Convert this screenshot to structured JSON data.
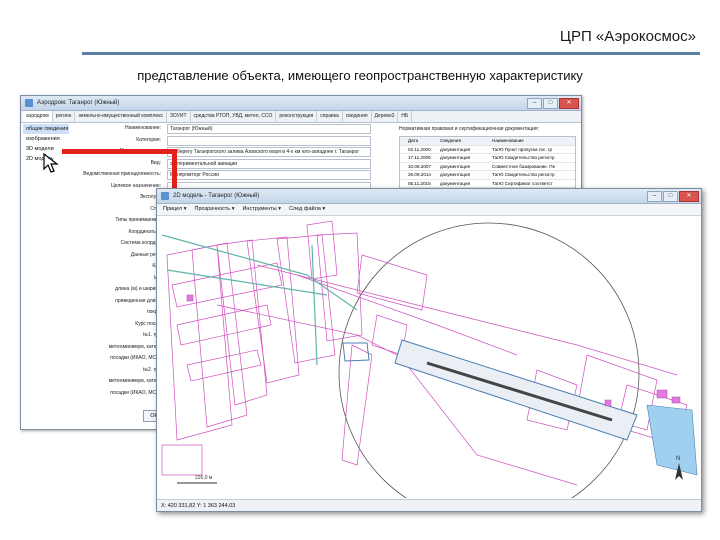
{
  "slide": {
    "title": "ЦРП «Аэрокосмос»",
    "subtitle": "представление объекта, имеющего геопространственную характеристику"
  },
  "colors": {
    "accent_rule": "#5b7fa7",
    "connector": "#e3201b",
    "map_lines": "#d04fbf",
    "runway": "#4b7fb0",
    "water": "#9fd0f0"
  },
  "window_back": {
    "title": "Аэродром: Таганрог (Южный)",
    "tabs": [
      "аэродром",
      "регион",
      "земельно-имущественный комплекс",
      "ЗОУИТ",
      "средства РТОП, УВД, метео, ССО",
      "реконструкция",
      "справка",
      "сведения",
      "Дерево3",
      "НБ"
    ],
    "nav": [
      "общие сведения",
      "изображения",
      "3D модели",
      "2D модель"
    ],
    "fields": [
      {
        "label": "Наименование:",
        "value": "Таганрог (Южный)"
      },
      {
        "label": "Категория:",
        "value": ""
      },
      {
        "label": "Местоположение:",
        "value": "на берегу Таганрогского залива Азовского моря в 4-х км юго-западнее г. Таганрог"
      },
      {
        "label": "Вид:",
        "value": "экспериментальной авиации"
      },
      {
        "label": "Ведомственная принадлежность:",
        "value": "Минпромторг России"
      },
      {
        "label": "Целевое назначение:",
        "value": ""
      },
      {
        "label": "Эксплуат",
        "value": ""
      },
      {
        "label": "Стат",
        "value": ""
      },
      {
        "label": "Типы принимаемых",
        "value": ""
      },
      {
        "label": "Координаты К",
        "value": ""
      },
      {
        "label": "Система координ",
        "value": ""
      },
      {
        "label": "Данные реес",
        "value": ""
      },
      {
        "label": "Кла",
        "value": ""
      },
      {
        "label": "ИВ",
        "value": ""
      },
      {
        "label": "длина (м) и ширина",
        "value": ""
      },
      {
        "label": "приведенная длина",
        "value": ""
      },
      {
        "label": "покры",
        "value": ""
      },
      {
        "label": "Курс посад",
        "value": ""
      },
      {
        "label": "№1. гра",
        "value": ""
      },
      {
        "label": "метеоминимум, катего",
        "value": ""
      },
      {
        "label": "посадки (ИКАО, МСА)",
        "value": ""
      },
      {
        "label": "№2. гра",
        "value": ""
      },
      {
        "label": "метеоминимум, катего",
        "value": ""
      },
      {
        "label": "посадки (ИКАО, МСА)",
        "value": ""
      }
    ],
    "doc_caption": "Нормативная правовая и сертификационная документация:",
    "doc_headers": [
      "Дата",
      "Сведения",
      "Наименование"
    ],
    "doc_rows": [
      {
        "date": "02.11.2000",
        "info": "документация",
        "name": "ТагЮ Пункт пропуска гос. гр"
      },
      {
        "date": "17.11.2005",
        "info": "документация",
        "name": "ТагЮ Свидетельство регистр"
      },
      {
        "date": "10.08.2007",
        "info": "документация",
        "name": "Совместное базирование. Пе"
      },
      {
        "date": "26.09.2014",
        "info": "документация",
        "name": "ТагЮ Свидетельство регистр"
      },
      {
        "date": "05.11.2015",
        "info": "документация",
        "name": "ТагЮ Сертификат соответст"
      },
      {
        "date": "05.11.2015",
        "info": "документация",
        "name": "ТагЮ Сертификат соответст"
      },
      {
        "date": "22.12.2015",
        "info": "документация",
        "name": "ТАНТК. Регламент государст"
      }
    ],
    "ok_label": "ОК"
  },
  "window_front": {
    "title": "2D модель - Таганрог (Южный)",
    "menu": [
      "Прицел ▾",
      "Прозрачность ▾",
      "Инструменты ▾",
      "След файла ▾"
    ],
    "scale_label": "226,0 м",
    "north_label": "N",
    "status": "Х: 420 331,82   Y: 1 363 244,03"
  }
}
